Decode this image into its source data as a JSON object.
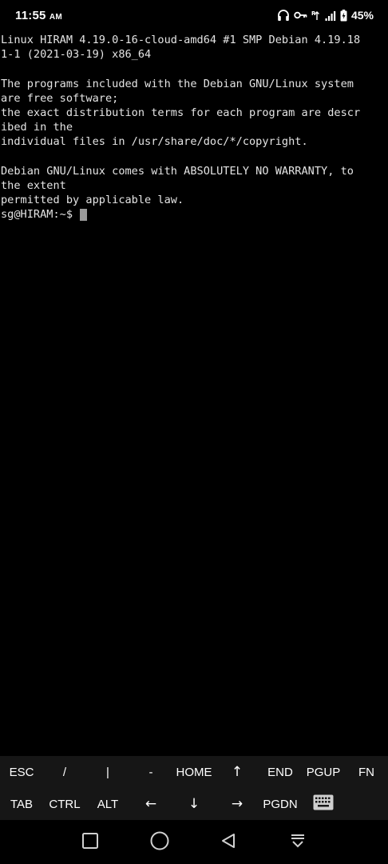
{
  "status_bar": {
    "time": "11:55",
    "time_suffix": "AM",
    "battery": "45%",
    "icons": [
      "headphones-icon",
      "vpn-key-icon",
      "wifi-calling-icon",
      "cellular-signal-icon",
      "battery-charging-icon"
    ]
  },
  "terminal": {
    "lines": [
      "Linux HIRAM 4.19.0-16-cloud-amd64 #1 SMP Debian 4.19.18",
      "1-1 (2021-03-19) x86_64",
      "",
      "The programs included with the Debian GNU/Linux system",
      "are free software;",
      "the exact distribution terms for each program are descr",
      "ibed in the",
      "individual files in /usr/share/doc/*/copyright.",
      "",
      "Debian GNU/Linux comes with ABSOLUTELY NO WARRANTY, to",
      "the extent",
      "permitted by applicable law."
    ],
    "prompt": "sg@HIRAM:~$ "
  },
  "extra_keys": {
    "row1": [
      {
        "name": "esc",
        "label": "ESC"
      },
      {
        "name": "slash",
        "label": "/"
      },
      {
        "name": "pipe",
        "label": "|"
      },
      {
        "name": "minus",
        "label": "-"
      },
      {
        "name": "home",
        "label": "HOME"
      },
      {
        "name": "up",
        "label": "↑"
      },
      {
        "name": "end",
        "label": "END"
      },
      {
        "name": "pgup",
        "label": "PGUP"
      },
      {
        "name": "fn",
        "label": "FN"
      }
    ],
    "row2": [
      {
        "name": "tab",
        "label": "TAB"
      },
      {
        "name": "ctrl",
        "label": "CTRL"
      },
      {
        "name": "alt",
        "label": "ALT"
      },
      {
        "name": "left",
        "label": "←"
      },
      {
        "name": "down",
        "label": "↓"
      },
      {
        "name": "right",
        "label": "→"
      },
      {
        "name": "pgdn",
        "label": "PGDN"
      }
    ],
    "keyboard_icon": "keyboard-icon"
  },
  "nav_bar": {
    "buttons": [
      "recent-apps-icon",
      "home-icon",
      "back-icon",
      "hide-keyboard-icon"
    ]
  },
  "colors": {
    "background": "#000000",
    "terminal_text": "#e4e4e4",
    "cursor": "#9a9a9a",
    "extra_keys_bg": "#161616"
  }
}
